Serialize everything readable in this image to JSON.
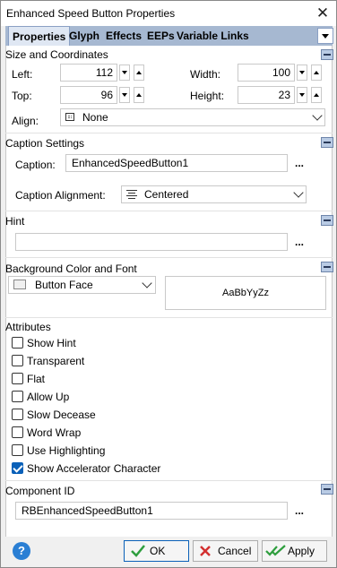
{
  "window": {
    "title": "Enhanced Speed Button Properties"
  },
  "tabs": [
    {
      "label": "Properties"
    },
    {
      "label": "Glyph"
    },
    {
      "label": "Effects"
    },
    {
      "label": "EEPs"
    },
    {
      "label": "Variable Links"
    }
  ],
  "size": {
    "header": "Size and Coordinates",
    "left_label": "Left:",
    "left_value": "112",
    "width_label": "Width:",
    "width_value": "100",
    "top_label": "Top:",
    "top_value": "96",
    "height_label": "Height:",
    "height_value": "23",
    "align_label": "Align:",
    "align_value": "None"
  },
  "caption": {
    "header": "Caption Settings",
    "caption_label": "Caption:",
    "caption_value": "EnhancedSpeedButton1",
    "alignment_label": "Caption Alignment:",
    "alignment_value": "Centered",
    "ellipsis": "..."
  },
  "hint": {
    "header": "Hint",
    "value": "",
    "ellipsis": "..."
  },
  "background": {
    "header": "Background Color and Font",
    "color_value": "Button Face",
    "font_preview": "AaBbYyZz"
  },
  "attributes": {
    "header": "Attributes",
    "items": [
      {
        "label": "Show Hint",
        "checked": false
      },
      {
        "label": "Transparent",
        "checked": false
      },
      {
        "label": "Flat",
        "checked": false
      },
      {
        "label": "Allow Up",
        "checked": false
      },
      {
        "label": "Slow Decease",
        "checked": false
      },
      {
        "label": "Word Wrap",
        "checked": false
      },
      {
        "label": "Use Highlighting",
        "checked": false
      },
      {
        "label": "Show Accelerator Character",
        "checked": true
      }
    ]
  },
  "component": {
    "header": "Component ID",
    "value": "RBEnhancedSpeedButton1",
    "ellipsis": "..."
  },
  "footer": {
    "help": "?",
    "ok_label": "OK",
    "cancel_label": "Cancel",
    "apply_label": "Apply"
  },
  "colors": {
    "accent": "#0a60b8",
    "tab_bar": "#a6b8d1",
    "ok_check": "#2e9e3e",
    "cancel_x": "#d33030"
  }
}
